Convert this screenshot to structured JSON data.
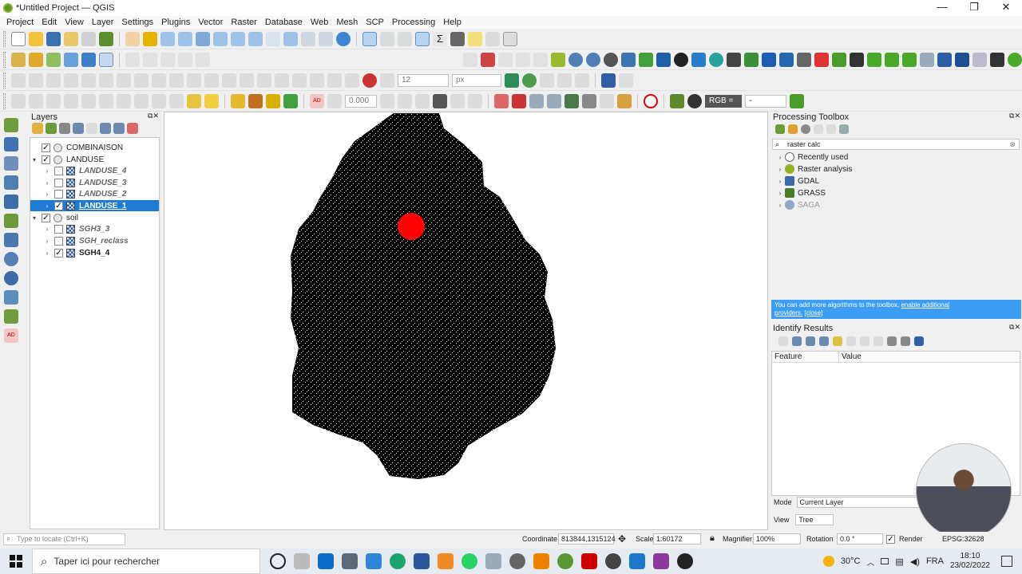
{
  "window": {
    "title": "*Untitled Project — QGIS",
    "minimize": "—",
    "maximize": "❐",
    "close": "✕"
  },
  "menu": [
    "Project",
    "Edit",
    "View",
    "Layer",
    "Settings",
    "Plugins",
    "Vector",
    "Raster",
    "Database",
    "Web",
    "Mesh",
    "SCP",
    "Processing",
    "Help"
  ],
  "toolbar": {
    "font_size": "12",
    "font_unit": "px",
    "scp_value": "0.000",
    "rgb_label": "RGB =",
    "rgb_value": "-"
  },
  "layers_panel": {
    "title": "Layers",
    "items": [
      {
        "label": "COMBINAISON",
        "checked": "✓",
        "arrow": ""
      },
      {
        "label": "LANDUSE",
        "checked": "✓",
        "arrow": "▾"
      },
      {
        "label": "LANDUSE_4",
        "checked": "",
        "arrow": "›"
      },
      {
        "label": "LANDUSE_3",
        "checked": "",
        "arrow": "›"
      },
      {
        "label": "LANDUSE_2",
        "checked": "",
        "arrow": "›"
      },
      {
        "label": "LANDUSE_1",
        "checked": "✓",
        "arrow": "›"
      },
      {
        "label": "soil",
        "checked": "✓",
        "arrow": "▾"
      },
      {
        "label": "SGH3_3",
        "checked": "",
        "arrow": "›"
      },
      {
        "label": "SGH_reclass",
        "checked": "",
        "arrow": "›"
      },
      {
        "label": "SGH4_4",
        "checked": "✓",
        "arrow": "›"
      }
    ]
  },
  "toolbox": {
    "title": "Processing Toolbox",
    "search_value": "raster calc",
    "items": [
      {
        "label": "Recently used",
        "icon": "clock-icon"
      },
      {
        "label": "Raster analysis",
        "icon": "qgis-icon"
      },
      {
        "label": "GDAL",
        "icon": "gdal-icon"
      },
      {
        "label": "GRASS",
        "icon": "grass-icon"
      },
      {
        "label": "SAGA",
        "icon": "saga-icon"
      }
    ],
    "info_text": "You can add more algorithms to the toolbox,",
    "info_link": "enable additional",
    "info_link2": "providers.",
    "info_close": "[close]"
  },
  "identify": {
    "title": "Identify Results",
    "col_feature": "Feature",
    "col_value": "Value",
    "mode_label": "Mode",
    "mode_value": "Current Layer",
    "view_label": "View",
    "view_value": "Tree"
  },
  "statusbar": {
    "locate_placeholder": "Type to locate (Ctrl+K)",
    "coordinate_label": "Coordinate",
    "coordinate_value": "813844,1315124",
    "scale_label": "Scale",
    "scale_value": "1:60172",
    "magnifier_label": "Magnifier",
    "magnifier_value": "100%",
    "rotation_label": "Rotation",
    "rotation_value": "0.0 °",
    "render_label": "Render",
    "crs": "EPSG:32628"
  },
  "taskbar": {
    "search_text": "Taper ici pour rechercher",
    "weather": "30°C",
    "lang": "FRA",
    "time": "18:10",
    "date": "23/02/2022"
  },
  "colors": {
    "accent": "#1e7ad3",
    "info": "#3d9df5",
    "cursor_dot": "#ff0000"
  }
}
